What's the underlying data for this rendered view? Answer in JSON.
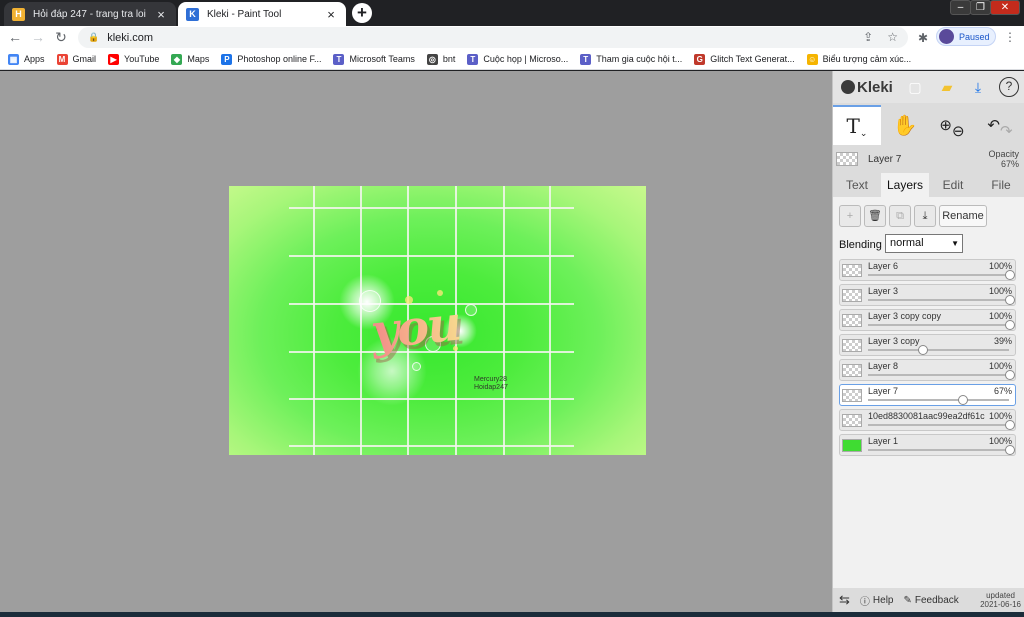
{
  "browser": {
    "tabs": [
      {
        "title": "Hỏi đáp 247 - trang tra loi",
        "active": false,
        "fav_color": "#f2b233",
        "fav_glyph": "H"
      },
      {
        "title": "Kleki - Paint Tool",
        "active": true,
        "fav_color": "#2f6fd6",
        "fav_glyph": "K"
      }
    ],
    "close_glyph": "×",
    "new_tab": "+",
    "window_controls": [
      "–",
      "❐",
      "✕"
    ],
    "url": "kleki.com",
    "profile_label": "Paused",
    "bookmarks": [
      {
        "label": "Apps",
        "icon": "apps-grid-icon",
        "color": "#4285f4"
      },
      {
        "label": "Gmail",
        "icon": "gmail-icon",
        "color": "#ea4335"
      },
      {
        "label": "YouTube",
        "icon": "youtube-icon",
        "color": "#ff0000"
      },
      {
        "label": "Maps",
        "icon": "maps-icon",
        "color": "#34a853"
      },
      {
        "label": "Photoshop online F...",
        "icon": "photoshop-icon",
        "color": "#1c73e8"
      },
      {
        "label": "Microsoft Teams",
        "icon": "teams-icon",
        "color": "#5b5fc7"
      },
      {
        "label": "bnt",
        "icon": "globe-icon",
        "color": "#444444"
      },
      {
        "label": "Cuộc họp | Microso...",
        "icon": "teams-icon",
        "color": "#5b5fc7"
      },
      {
        "label": "Tham gia cuộc hội t...",
        "icon": "teams-icon",
        "color": "#5b5fc7"
      },
      {
        "label": "Glitch Text Generat...",
        "icon": "glitch-icon",
        "color": "#c0392b"
      },
      {
        "label": "Biểu tượng cảm xúc...",
        "icon": "emoji-icon",
        "color": "#f5b400"
      }
    ]
  },
  "canvas": {
    "artwork_text": "you",
    "watermark_line1": "Mercury28",
    "watermark_line2": "Hoidap247"
  },
  "panel": {
    "logo": "Kleki",
    "current_layer": {
      "name": "Layer 7",
      "opacity_label": "Opacity",
      "opacity_value": "67%"
    },
    "tabs": [
      {
        "label": "Text",
        "active": false
      },
      {
        "label": "Layers",
        "active": true
      },
      {
        "label": "Edit",
        "active": false
      },
      {
        "label": "File",
        "active": false
      }
    ],
    "rename_label": "Rename",
    "blending_label": "Blending",
    "blending_value": "normal",
    "layers": [
      {
        "name": "Layer 6",
        "opacity": "100%",
        "opacity_fraction": 1.0,
        "selected": false
      },
      {
        "name": "Layer 3",
        "opacity": "100%",
        "opacity_fraction": 1.0,
        "selected": false
      },
      {
        "name": "Layer 3 copy copy",
        "opacity": "100%",
        "opacity_fraction": 1.0,
        "selected": false
      },
      {
        "name": "Layer 3 copy",
        "opacity": "39%",
        "opacity_fraction": 0.39,
        "selected": false
      },
      {
        "name": "Layer 8",
        "opacity": "100%",
        "opacity_fraction": 1.0,
        "selected": false
      },
      {
        "name": "Layer 7",
        "opacity": "67%",
        "opacity_fraction": 0.67,
        "selected": true
      },
      {
        "name": "10ed8830081aac99ea2df61c",
        "opacity": "100%",
        "opacity_fraction": 1.0,
        "selected": false
      },
      {
        "name": "Layer 1",
        "opacity": "100%",
        "opacity_fraction": 1.0,
        "selected": false,
        "thumb_color": "#3fdc32"
      }
    ],
    "footer": {
      "help_label": "Help",
      "feedback_label": "Feedback",
      "updated_label": "updated",
      "updated_date": "2021-06-16"
    }
  }
}
